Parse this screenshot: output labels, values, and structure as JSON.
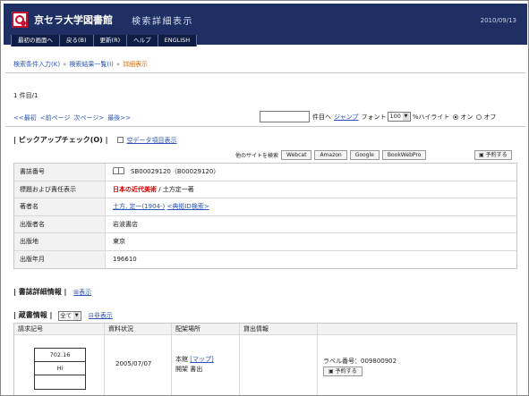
{
  "header": {
    "library_name": "京セラ大学図書館",
    "page_mode": "検索詳細表示",
    "date": "2010/09/13",
    "nav": [
      {
        "label": "最初の画面へ"
      },
      {
        "label": "戻る(B)"
      },
      {
        "label": "更新(R)"
      },
      {
        "label": "ヘルプ"
      },
      {
        "label": "ENGLISH"
      }
    ]
  },
  "breadcrumb": {
    "step1": "検索条件入力(K)",
    "step2": "検索結果一覧(I)",
    "current": "詳細表示",
    "separator": "»"
  },
  "result": {
    "count": "1 件目/1"
  },
  "pager": {
    "first": "<<最初",
    "prev": "<前ページ",
    "next": "次ページ>",
    "last": "最後>>"
  },
  "controls": {
    "jump_suffix": "件目へ",
    "jump_link": "ジャンプ",
    "font_label": "フォント",
    "font_size": "100",
    "percent_label": "%",
    "highlight_label": "ハイライト",
    "on_label": "オン",
    "off_label": "オフ"
  },
  "pickup": {
    "title": "ピックアップチェック(O)",
    "empty_link": "空データ項目表示"
  },
  "external": {
    "label": "他のサイトを検索",
    "buttons": [
      "Webcat",
      "Amazon",
      "Google",
      "BookWebPro"
    ],
    "reserve": "予約する"
  },
  "bib": [
    {
      "key": "書誌番号",
      "value": "SB00029120（B00029120）"
    },
    {
      "key": "標題および責任表示",
      "title": "日本の近代美術",
      "rest": " / 土方定一著"
    },
    {
      "key": "著者名",
      "link1": "土方, 定一(1904-)",
      "link2": "<典拠ID検索>"
    },
    {
      "key": "出版者名",
      "value": "岩波書店"
    },
    {
      "key": "出版地",
      "value": "東京"
    },
    {
      "key": "出版年月",
      "value": "196610"
    }
  ],
  "detail": {
    "title": "書誌詳細情報",
    "link": "表示"
  },
  "holdings": {
    "title": "蔵書情報",
    "filter": "全て",
    "hide_link": "非表示",
    "headers": [
      "請求記号",
      "資料状況",
      "配架場所",
      "貸出情報",
      ""
    ],
    "call_number": [
      "702.16",
      "Hi",
      ""
    ],
    "status_date": "2005/07/07",
    "location": "本館",
    "map_link": "マップ",
    "shelf": "開架 書出",
    "label_number": "ラベル番号：009800902",
    "reserve": "予約する"
  },
  "colors": {
    "header_bg": "#1e2f63",
    "link": "#2b54b8",
    "title_red": "#d40000",
    "crumb_current": "#d96a00"
  }
}
